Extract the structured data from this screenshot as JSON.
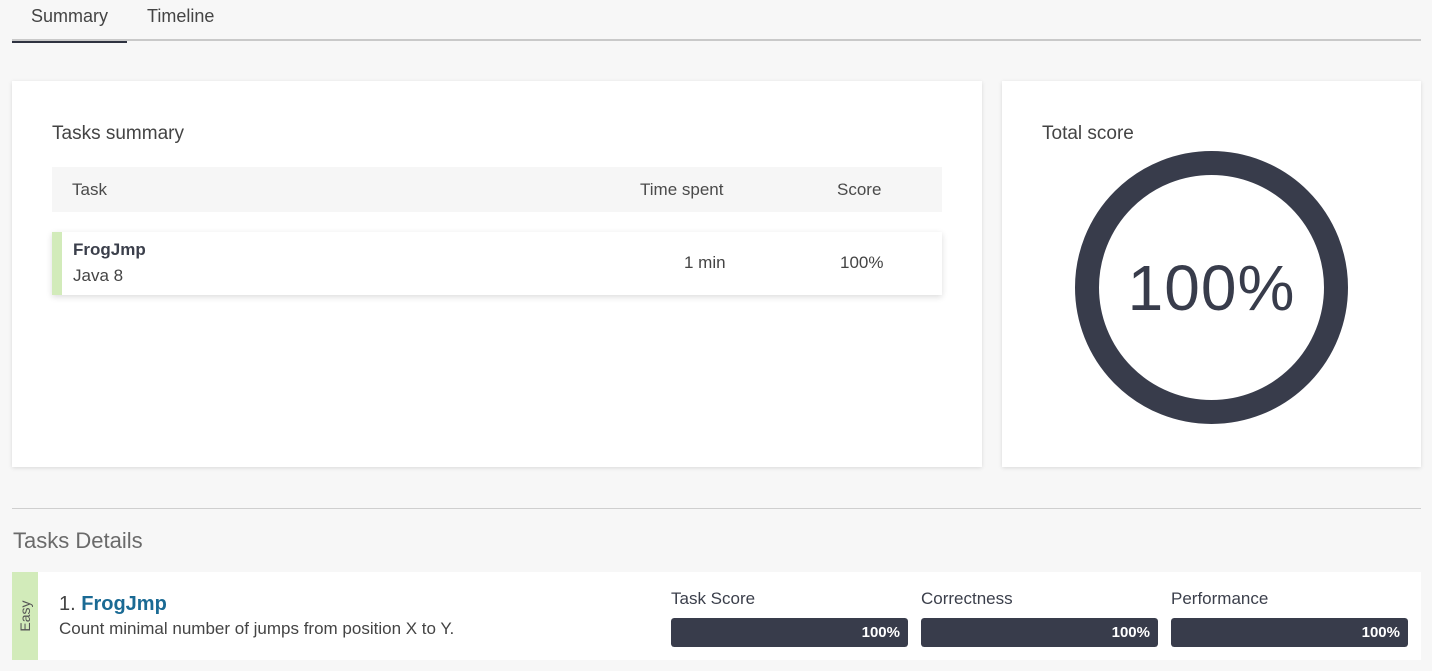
{
  "tabs": [
    {
      "label": "Summary",
      "active": true
    },
    {
      "label": "Timeline",
      "active": false
    }
  ],
  "tasks_summary": {
    "title": "Tasks summary",
    "columns": [
      "Task",
      "Time spent",
      "Score"
    ],
    "rows": [
      {
        "name": "FrogJmp",
        "language": "Java 8",
        "time_spent": "1 min",
        "score": "100%"
      }
    ]
  },
  "total_score": {
    "title": "Total score",
    "value": "100%",
    "ring_color": "#383c4b"
  },
  "tasks_details": {
    "title": "Tasks Details",
    "items": [
      {
        "difficulty": "Easy",
        "difficulty_color": "#d2ebba",
        "number": "1.",
        "name": "FrogJmp",
        "description": "Count minimal number of jumps from position X to Y.",
        "metrics": [
          {
            "label": "Task Score",
            "value": "100%",
            "fraction": 1.0
          },
          {
            "label": "Correctness",
            "value": "100%",
            "fraction": 1.0
          },
          {
            "label": "Performance",
            "value": "100%",
            "fraction": 1.0
          }
        ]
      }
    ]
  }
}
